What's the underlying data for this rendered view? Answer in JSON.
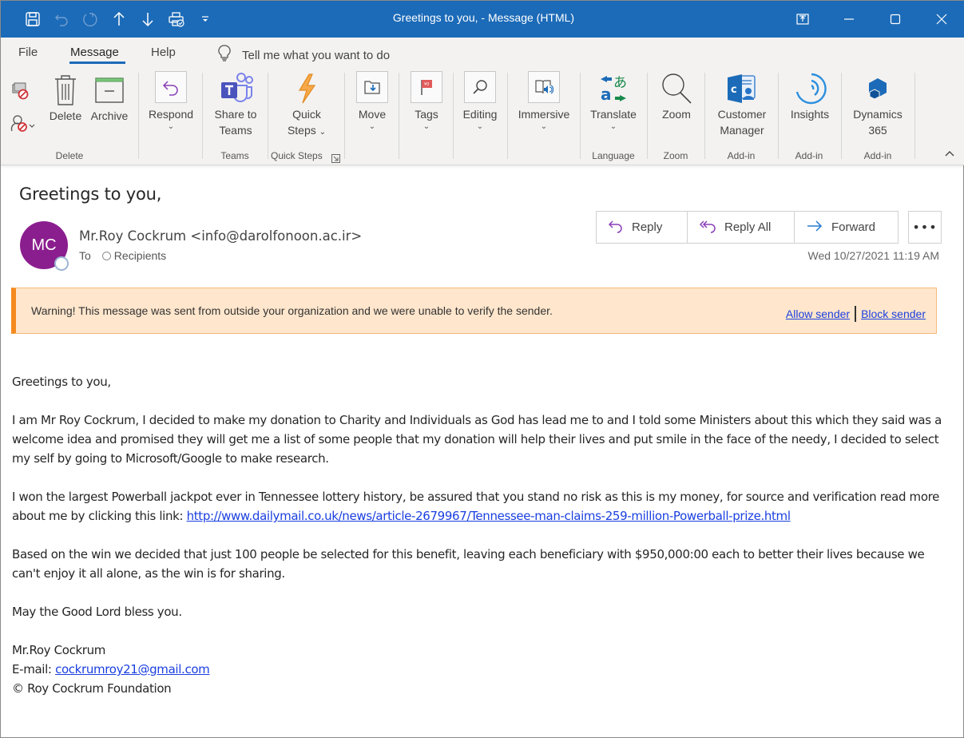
{
  "window": {
    "title": "Greetings to you,  -  Message (HTML)",
    "qat": [
      "save-icon",
      "undo-icon",
      "redo-icon",
      "previous-item-icon",
      "next-item-icon",
      "print-icon",
      "customize-qat-icon"
    ],
    "controls": [
      "ribbon-display-options-icon",
      "minimize-icon",
      "maximize-icon",
      "close-icon"
    ]
  },
  "ribbon_tabs": [
    {
      "label": "File",
      "active": false
    },
    {
      "label": "Message",
      "active": true
    },
    {
      "label": "Help",
      "active": false
    }
  ],
  "tell_me": {
    "placeholder": "Tell me what you want to do"
  },
  "ribbon": {
    "groups": [
      {
        "label": "Delete",
        "buttons": [
          {
            "label": "Ignore"
          },
          {
            "label": "Junk"
          },
          {
            "label": "Delete"
          },
          {
            "label": "Archive"
          }
        ]
      },
      {
        "label": "",
        "buttons": [
          {
            "label": "Respond"
          }
        ]
      },
      {
        "label": "Teams",
        "buttons": [
          {
            "label": "Share to",
            "label2": "Teams"
          }
        ]
      },
      {
        "label": "Quick Steps",
        "buttons": [
          {
            "label": "Quick",
            "label2": "Steps"
          }
        ]
      },
      {
        "label": "",
        "buttons": [
          {
            "label": "Move"
          }
        ]
      },
      {
        "label": "",
        "buttons": [
          {
            "label": "Tags"
          }
        ]
      },
      {
        "label": "",
        "buttons": [
          {
            "label": "Editing"
          }
        ]
      },
      {
        "label": "",
        "buttons": [
          {
            "label": "Immersive"
          }
        ]
      },
      {
        "label": "Language",
        "buttons": [
          {
            "label": "Translate"
          }
        ]
      },
      {
        "label": "Zoom",
        "buttons": [
          {
            "label": "Zoom"
          }
        ]
      },
      {
        "label": "Add-in",
        "buttons": [
          {
            "label": "Customer",
            "label2": "Manager"
          }
        ]
      },
      {
        "label": "Add-in",
        "buttons": [
          {
            "label": "Insights"
          }
        ]
      },
      {
        "label": "Add-in",
        "buttons": [
          {
            "label": "Dynamics",
            "label2": "365"
          }
        ]
      }
    ]
  },
  "message": {
    "subject": "Greetings to you,",
    "avatar_initials": "MC",
    "avatar_color": "#8b1e8e",
    "sender": "Mr.Roy Cockrum <info@darolfonoon.ac.ir>",
    "to_label": "To",
    "recipients": "Recipients",
    "date": "Wed 10/27/2021 11:19 AM",
    "actions": {
      "reply": "Reply",
      "reply_all": "Reply All",
      "forward": "Forward",
      "more": "•••"
    }
  },
  "warning": {
    "text": "Warning! This message was sent from outside your organization and we were unable to verify the sender.",
    "allow": "Allow sender",
    "block": "Block sender",
    "accent": "#f58a1f",
    "background": "#ffe6cc"
  },
  "body": {
    "greeting": "Greetings to you,",
    "p1": "I am Mr Roy Cockrum, I decided to make my donation to Charity and Individuals as God has lead me to and I told some Ministers about this which they said was a welcome idea and promised they will get me a list of some people that my donation will help their lives and put smile in the face of the needy, I decided to select my self by going to Microsoft/Google to make research.",
    "p2_prefix": "I won the largest Powerball jackpot ever in Tennessee lottery history, be assured that you stand no risk as this is my money, for source and verification read more about me by clicking this link: ",
    "p2_link": "http://www.dailymail.co.uk/news/article-2679967/Tennessee-man-claims-259-million-Powerball-prize.html",
    "p3": "Based on the win we decided that just 100 people be selected for this benefit, leaving each beneficiary with $950,000:00 each to better their lives because we can't enjoy it all alone, as the win is for sharing.",
    "p4": "May the Good Lord bless you.",
    "sig_name": "Mr.Roy Cockrum",
    "sig_email_label": "E-mail: ",
    "sig_email": "cockrumroy21@gmail.com",
    "sig_org": "© Roy Cockrum Foundation"
  }
}
